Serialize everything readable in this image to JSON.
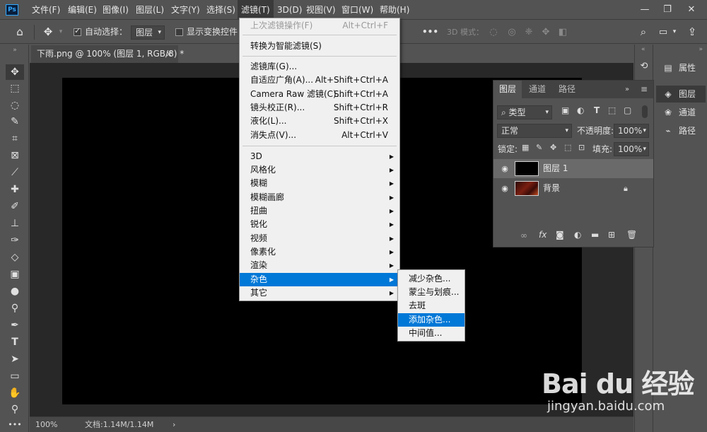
{
  "app": {
    "logo": "Ps"
  },
  "menubar": {
    "items": [
      "文件(F)",
      "编辑(E)",
      "图像(I)",
      "图层(L)",
      "文字(Y)",
      "选择(S)",
      "滤镜(T)",
      "3D(D)",
      "视图(V)",
      "窗口(W)",
      "帮助(H)"
    ],
    "active_index": 6,
    "window_controls": {
      "minimize": "—",
      "restore": "❐",
      "close": "✕"
    }
  },
  "options": {
    "auto_select_label": "自动选择：",
    "auto_select_checked": true,
    "auto_select_target": "图层",
    "show_transform_label": "显示变换控件",
    "show_transform_checked": false,
    "more": "•••",
    "mode_3d_label": "3D 模式："
  },
  "document": {
    "tab_title": "下雨.png @ 100% (图层 1, RGB/8) *",
    "close": "×",
    "canvas_color": "#000000"
  },
  "status": {
    "zoom": "100%",
    "doc_info": "文档:1.14M/1.14M",
    "arrow": "›"
  },
  "dock": {
    "properties": "属性",
    "layers": "图层",
    "channels": "通道",
    "paths": "路径"
  },
  "layers_panel": {
    "tabs": [
      "图层",
      "通道",
      "路径"
    ],
    "active_tab": 0,
    "filter_kind": "类型",
    "blend_mode": "正常",
    "opacity_label": "不透明度:",
    "opacity_value": "100%",
    "lock_label": "锁定:",
    "fill_label": "填充:",
    "fill_value": "100%",
    "layers": [
      {
        "name": "图层 1",
        "selected": true,
        "locked": false
      },
      {
        "name": "背景",
        "selected": false,
        "locked": true
      }
    ]
  },
  "filter_menu": {
    "items": [
      {
        "label": "上次滤镜操作(F)",
        "shortcut": "Alt+Ctrl+F",
        "disabled": true
      },
      {
        "sep": true
      },
      {
        "label": "转换为智能滤镜(S)"
      },
      {
        "sep": true
      },
      {
        "label": "滤镜库(G)..."
      },
      {
        "label": "自适应广角(A)...",
        "shortcut": "Alt+Shift+Ctrl+A"
      },
      {
        "label": "Camera Raw 滤镜(C)...",
        "shortcut": "Shift+Ctrl+A"
      },
      {
        "label": "镜头校正(R)...",
        "shortcut": "Shift+Ctrl+R"
      },
      {
        "label": "液化(L)...",
        "shortcut": "Shift+Ctrl+X"
      },
      {
        "label": "消失点(V)...",
        "shortcut": "Alt+Ctrl+V"
      },
      {
        "sep": true
      },
      {
        "label": "3D",
        "submenu": true
      },
      {
        "label": "风格化",
        "submenu": true
      },
      {
        "label": "模糊",
        "submenu": true
      },
      {
        "label": "模糊画廊",
        "submenu": true
      },
      {
        "label": "扭曲",
        "submenu": true
      },
      {
        "label": "锐化",
        "submenu": true
      },
      {
        "label": "视频",
        "submenu": true
      },
      {
        "label": "像素化",
        "submenu": true
      },
      {
        "label": "渲染",
        "submenu": true
      },
      {
        "label": "杂色",
        "submenu": true,
        "hover": true
      },
      {
        "label": "其它",
        "submenu": true
      }
    ]
  },
  "noise_menu": {
    "items": [
      "减少杂色...",
      "蒙尘与划痕...",
      "去斑",
      "添加杂色...",
      "中间值..."
    ],
    "hover_index": 3
  },
  "watermark": {
    "logo": "Bai du 经验",
    "url": "jingyan.baidu.com"
  },
  "colors": {
    "accent": "#0078d7",
    "panel": "#535353",
    "canvas_bg": "#282828"
  }
}
